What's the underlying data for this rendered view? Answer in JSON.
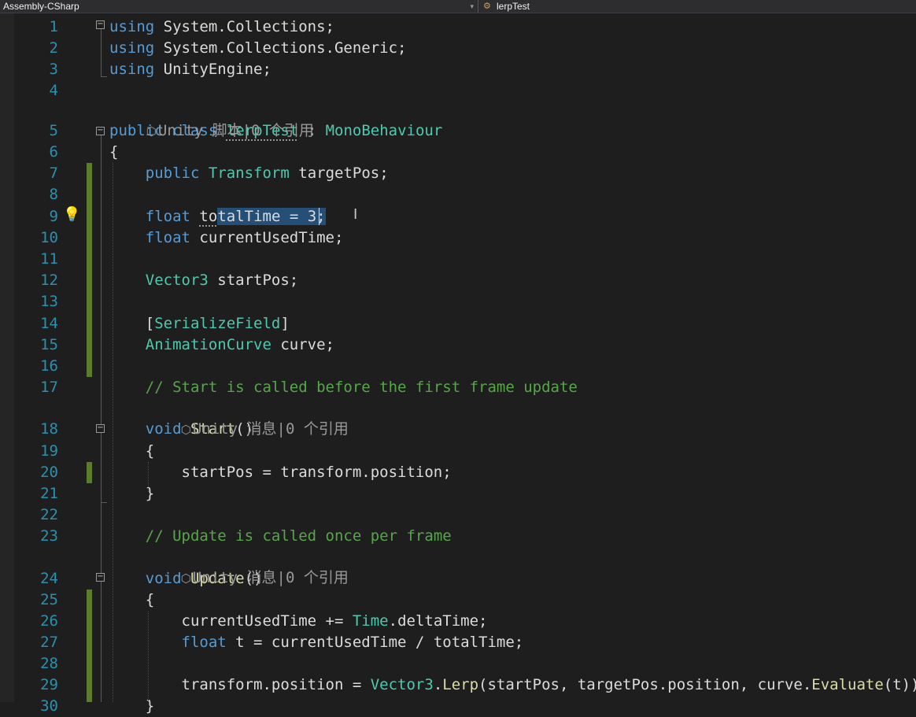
{
  "toolbar": {
    "project": "Assembly-CSharp",
    "member": "lerpTest",
    "member_icon": "class-icon"
  },
  "codelens": {
    "class": "Unity 脚本|0 个引用",
    "start": "Unity 消息|0 个引用",
    "update": "Unity 消息|0 个引用"
  },
  "lines": [
    {
      "n": "1",
      "parts": [
        [
          "kw",
          "using"
        ],
        [
          "id",
          " System.Collections;"
        ]
      ]
    },
    {
      "n": "2",
      "parts": [
        [
          "kw",
          "using"
        ],
        [
          "id",
          " System.Collections.Generic;"
        ]
      ]
    },
    {
      "n": "3",
      "parts": [
        [
          "kw",
          "using"
        ],
        [
          "id",
          " UnityEngine;"
        ]
      ]
    },
    {
      "n": "4",
      "parts": []
    },
    {
      "n": "5",
      "parts": [
        [
          "kw",
          "public"
        ],
        [
          "id",
          " "
        ],
        [
          "kw",
          "class"
        ],
        [
          "id",
          " "
        ],
        [
          "tyd",
          "lerpTest"
        ],
        [
          "id",
          " : "
        ],
        [
          "ty",
          "MonoBehaviour"
        ]
      ]
    },
    {
      "n": "6",
      "parts": [
        [
          "id",
          "{"
        ]
      ]
    },
    {
      "n": "7",
      "parts": [
        [
          "id",
          "    "
        ],
        [
          "kw",
          "public"
        ],
        [
          "id",
          " "
        ],
        [
          "ty",
          "Transform"
        ],
        [
          "id",
          " targetPos;"
        ]
      ]
    },
    {
      "n": "8",
      "parts": []
    },
    {
      "n": "9",
      "parts": [
        [
          "id",
          "    "
        ],
        [
          "kw",
          "float"
        ],
        [
          "id",
          " "
        ],
        [
          "idd",
          "to"
        ],
        [
          "sel",
          "talTime = 3;"
        ]
      ]
    },
    {
      "n": "10",
      "parts": [
        [
          "id",
          "    "
        ],
        [
          "kw",
          "float"
        ],
        [
          "id",
          " currentUsedTime;"
        ]
      ]
    },
    {
      "n": "11",
      "parts": []
    },
    {
      "n": "12",
      "parts": [
        [
          "id",
          "    "
        ],
        [
          "ty",
          "Vector3"
        ],
        [
          "id",
          " startPos;"
        ]
      ]
    },
    {
      "n": "13",
      "parts": []
    },
    {
      "n": "14",
      "parts": [
        [
          "id",
          "    ["
        ],
        [
          "ty",
          "SerializeField"
        ],
        [
          "id",
          "]"
        ]
      ]
    },
    {
      "n": "15",
      "parts": [
        [
          "id",
          "    "
        ],
        [
          "ty",
          "AnimationCurve"
        ],
        [
          "id",
          " curve;"
        ]
      ]
    },
    {
      "n": "16",
      "parts": []
    },
    {
      "n": "17",
      "parts": [
        [
          "id",
          "    "
        ],
        [
          "cm",
          "// Start is called before the first frame update"
        ]
      ]
    },
    {
      "n": "18",
      "parts": [
        [
          "id",
          "    "
        ],
        [
          "kw",
          "void"
        ],
        [
          "id",
          " "
        ],
        [
          "mt",
          "Start"
        ],
        [
          "id",
          "()"
        ]
      ]
    },
    {
      "n": "19",
      "parts": [
        [
          "id",
          "    {"
        ]
      ]
    },
    {
      "n": "20",
      "parts": [
        [
          "id",
          "        startPos = transform.position;"
        ]
      ]
    },
    {
      "n": "21",
      "parts": [
        [
          "id",
          "    }"
        ]
      ]
    },
    {
      "n": "22",
      "parts": []
    },
    {
      "n": "23",
      "parts": [
        [
          "id",
          "    "
        ],
        [
          "cm",
          "// Update is called once per frame"
        ]
      ]
    },
    {
      "n": "24",
      "parts": [
        [
          "id",
          "    "
        ],
        [
          "kw",
          "void"
        ],
        [
          "id",
          " "
        ],
        [
          "mt",
          "Update"
        ],
        [
          "id",
          "()"
        ]
      ]
    },
    {
      "n": "25",
      "parts": [
        [
          "id",
          "    {"
        ]
      ]
    },
    {
      "n": "26",
      "parts": [
        [
          "id",
          "        currentUsedTime += "
        ],
        [
          "ty",
          "Time"
        ],
        [
          "id",
          ".deltaTime;"
        ]
      ]
    },
    {
      "n": "27",
      "parts": [
        [
          "id",
          "        "
        ],
        [
          "kw",
          "float"
        ],
        [
          "id",
          " t = currentUsedTime / totalTime;"
        ]
      ]
    },
    {
      "n": "28",
      "parts": []
    },
    {
      "n": "29",
      "parts": [
        [
          "id",
          "        transform.position = "
        ],
        [
          "ty",
          "Vector3"
        ],
        [
          "id",
          "."
        ],
        [
          "mt",
          "Lerp"
        ],
        [
          "id",
          "(startPos, targetPos.position, curve."
        ],
        [
          "mt",
          "Evaluate"
        ],
        [
          "id",
          "(t));"
        ]
      ]
    },
    {
      "n": "30",
      "parts": [
        [
          "id",
          "    }"
        ]
      ]
    }
  ]
}
